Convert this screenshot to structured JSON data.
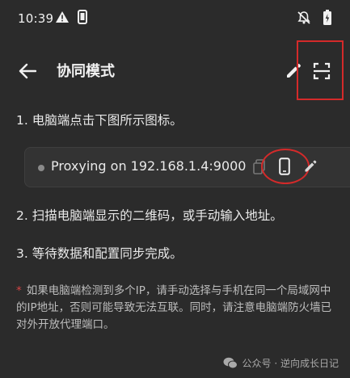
{
  "status_bar": {
    "time": "10:39"
  },
  "app_bar": {
    "title": "协同模式"
  },
  "steps": [
    {
      "text": "1. 电脑端点击下图所示图标。"
    },
    {
      "text": "2. 扫描电脑端显示的二维码，或手动输入地址。"
    },
    {
      "text": "3. 等待数据和配置同步完成。"
    }
  ],
  "proxy_bar": {
    "status_text": "Proxying on 192.168.1.4:9000"
  },
  "note": {
    "star": "*",
    "text": "如果电脑端检测到多个IP，请手动选择与手机在同一个局域网中的IP地址，否则可能导致无法互联。同时，请注意电脑端防火墙已对外开放代理端口。"
  },
  "watermark": {
    "text": "公众号 · 逆向成长日记"
  },
  "colors": {
    "background": "#2b2b2b",
    "highlight_red": "#d42a2a"
  }
}
